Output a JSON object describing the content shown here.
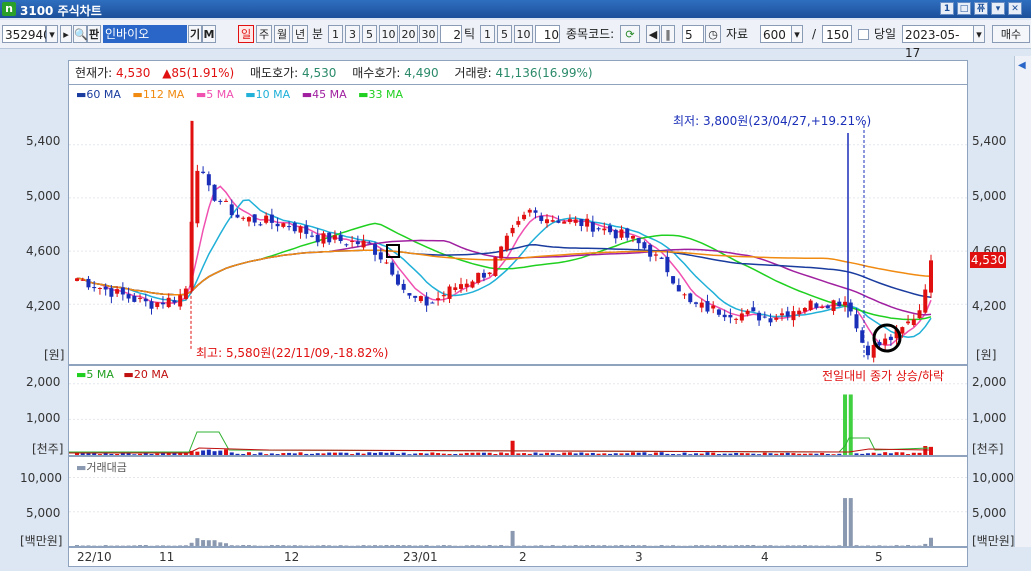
{
  "window": {
    "title": "3100 주식차트",
    "logo": "n",
    "buttons": [
      "1",
      "□",
      "퓨",
      "▾",
      "1",
      "□",
      "?",
      "✕"
    ]
  },
  "toolbar": {
    "code": "352940",
    "name": "인바이오",
    "gi": "기",
    "m": "M",
    "periods": [
      "일",
      "주",
      "월",
      "년"
    ],
    "bun": "분",
    "minutes": [
      "1",
      "3",
      "5",
      "10",
      "20",
      "30"
    ],
    "tick_value": "2",
    "tick_label": "틱",
    "secs": [
      "1",
      "5",
      "10"
    ],
    "sec_value": "10",
    "code_label": "종목코드:",
    "count": "5",
    "data_label": "자료",
    "data_count": "600",
    "slash": "/",
    "total": "150",
    "dangil": "당일",
    "date": "2023-05-17",
    "sell": "매수"
  },
  "quote": {
    "cur_label": "현재가:",
    "cur": "4,530",
    "chg": "▲85(1.91%)",
    "ask_label": "매도호가:",
    "ask": "4,530",
    "bid_label": "매수호가:",
    "bid": "4,490",
    "vol_label": "거래량:",
    "vol": "41,136(16.99%)"
  },
  "colors": {
    "up": "#e01010",
    "down": "#1a2fb8",
    "ma60": "#1a3c9e",
    "ma112": "#f08a10",
    "ma5": "#f050b0",
    "ma10": "#20b0d8",
    "ma45": "#a020a0",
    "ma33": "#20d020",
    "bg": "#ffffff"
  },
  "price_panel": {
    "legend": [
      "60 MA",
      "112 MA",
      "5 MA",
      "10 MA",
      "45 MA",
      "33 MA"
    ],
    "y_ticks": [
      "5,400",
      "5,000",
      "4,600",
      "4,200"
    ],
    "unit": "[원]",
    "low_note": "최저: 3,800원(23/04/27,+19.21%)",
    "high_note": "최고: 5,580원(22/11/09,-18.82%)",
    "current_tag": "4,530",
    "hidden_tick": "4,600"
  },
  "volume_panel": {
    "legend": [
      "5 MA",
      "20 MA"
    ],
    "y_ticks": [
      "2,000",
      "1,000"
    ],
    "unit": "[천주]",
    "note": "전일대비 종가 상승/하락"
  },
  "amount_panel": {
    "legend": "거래대금",
    "y_ticks": [
      "10,000",
      "5,000"
    ],
    "unit": "[백만원]"
  },
  "x_axis": [
    "22/10",
    "11",
    "12",
    "23/01",
    "2",
    "3",
    "4",
    "5"
  ],
  "chart_data": {
    "type": "candlestick",
    "ylim": [
      3750,
      5850
    ],
    "x_labels": [
      "22/10",
      "11",
      "12",
      "23/01",
      "2",
      "3",
      "4",
      "5"
    ],
    "highest": {
      "value": 5580,
      "date": "22/11/09"
    },
    "lowest": {
      "value": 3800,
      "date": "23/04/27"
    },
    "last_close": 4530,
    "series_names": [
      "60 MA",
      "112 MA",
      "5 MA",
      "10 MA",
      "45 MA",
      "33 MA"
    ]
  }
}
